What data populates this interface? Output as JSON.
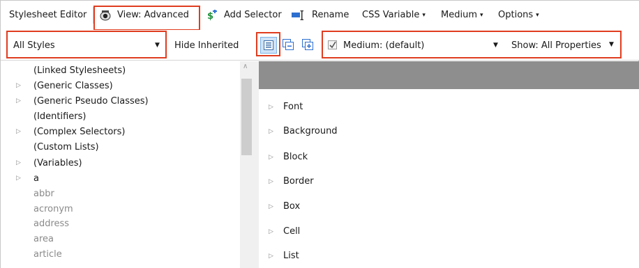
{
  "toolbar1": {
    "title": "Stylesheet Editor",
    "view_label": "View: Advanced",
    "add_selector_label": "Add Selector",
    "rename_label": "Rename",
    "css_variable_label": "CSS Variable",
    "medium_label": "Medium",
    "options_label": "Options"
  },
  "toolbar2": {
    "styles_select_value": "All Styles",
    "hide_inherited_label": "Hide Inherited",
    "medium_checked": true,
    "medium_select_value": "Medium: (default)",
    "show_select_value": "Show: All Properties"
  },
  "tree": {
    "items": [
      {
        "label": "(Linked Stylesheets)",
        "expandable": false,
        "muted": false
      },
      {
        "label": "(Generic Classes)",
        "expandable": true,
        "muted": false
      },
      {
        "label": "(Generic Pseudo Classes)",
        "expandable": true,
        "muted": false
      },
      {
        "label": "(Identifiers)",
        "expandable": false,
        "muted": false
      },
      {
        "label": "(Complex Selectors)",
        "expandable": true,
        "muted": false
      },
      {
        "label": "(Custom Lists)",
        "expandable": false,
        "muted": false
      },
      {
        "label": "(Variables)",
        "expandable": true,
        "muted": false
      },
      {
        "label": "a",
        "expandable": true,
        "muted": false
      },
      {
        "label": "abbr",
        "expandable": false,
        "muted": true
      },
      {
        "label": "acronym",
        "expandable": false,
        "muted": true
      },
      {
        "label": "address",
        "expandable": false,
        "muted": true
      },
      {
        "label": "area",
        "expandable": false,
        "muted": true
      },
      {
        "label": "article",
        "expandable": false,
        "muted": true
      }
    ]
  },
  "properties": {
    "categories": [
      "Font",
      "Background",
      "Block",
      "Border",
      "Box",
      "Cell",
      "List"
    ]
  },
  "colors": {
    "highlight": "#e03c1f",
    "header_bar": "#8e8e8e",
    "icon_blue": "#2d6fcf",
    "icon_green": "#1f8f3a"
  }
}
